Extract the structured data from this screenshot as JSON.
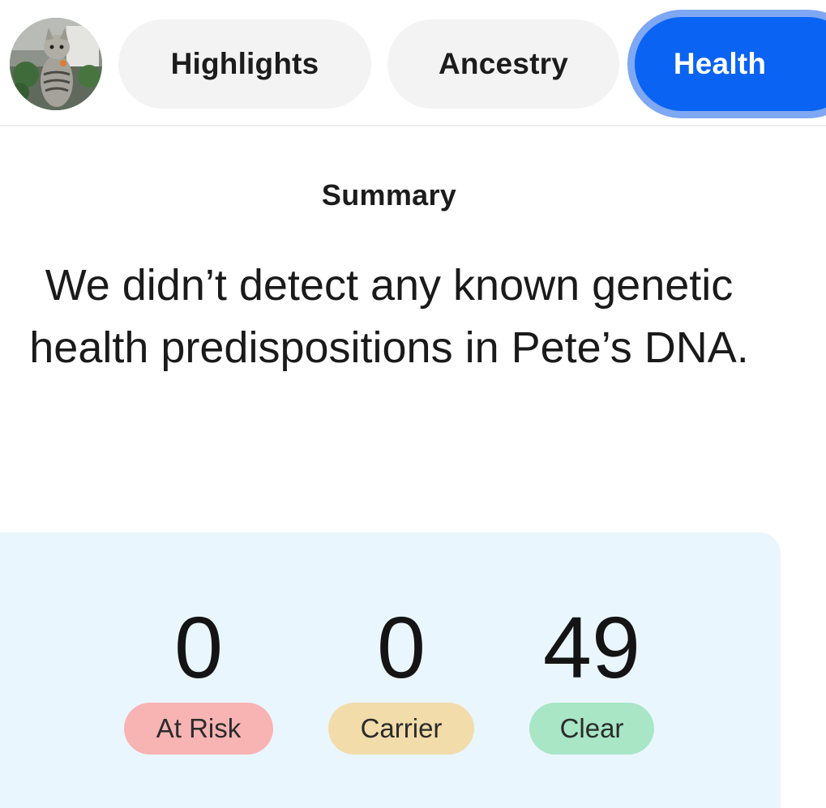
{
  "tabs": {
    "highlights": "Highlights",
    "ancestry": "Ancestry",
    "health": "Health",
    "active": "Health"
  },
  "summary": {
    "label": "Summary",
    "headline": "We didn’t detect any known genetic health predispositions in Pete’s DNA."
  },
  "results": [
    {
      "count": "0",
      "label": "At Risk",
      "color": "#f8b3b3"
    },
    {
      "count": "0",
      "label": "Carrier",
      "color": "#f2dcaa"
    },
    {
      "count": "49",
      "label": "Clear",
      "color": "#a8e6c6"
    }
  ],
  "colors": {
    "accent": "#0a63f2",
    "accent_ring": "#7ea7f4",
    "card_background": "#eaf6fd",
    "tab_background": "#f3f3f3"
  },
  "icons": {
    "avatar": "cat-photo-avatar"
  }
}
